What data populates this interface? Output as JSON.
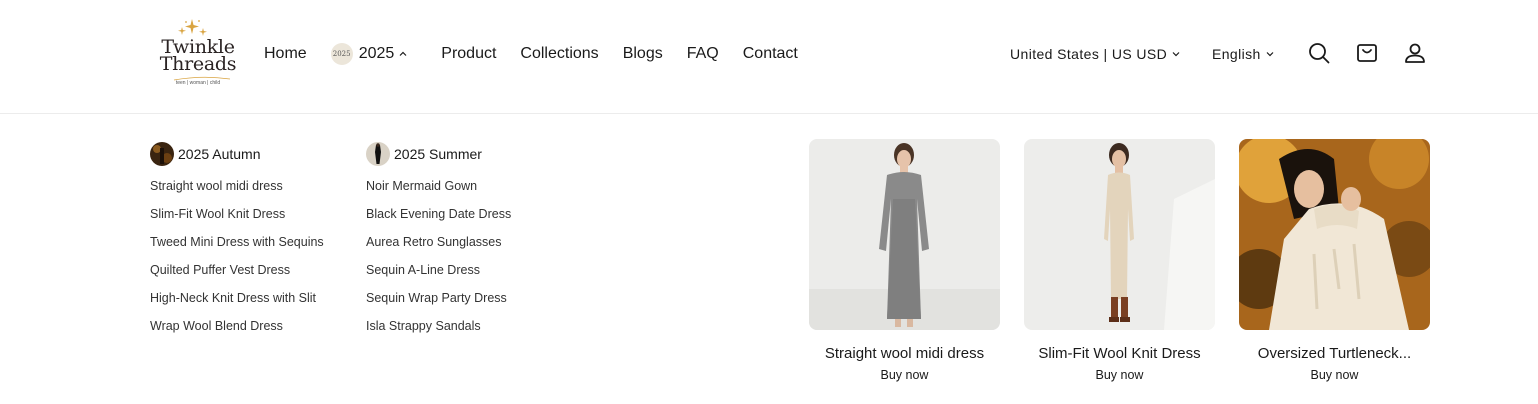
{
  "brand": {
    "name_line1": "Twinkle",
    "name_line2": "Threads",
    "tagline": "teen | woman | child"
  },
  "nav": {
    "items": [
      {
        "label": "Home"
      },
      {
        "label": "2025",
        "badge": "2025",
        "has_dropdown": true
      },
      {
        "label": "Product"
      },
      {
        "label": "Collections"
      },
      {
        "label": "Blogs"
      },
      {
        "label": "FAQ"
      },
      {
        "label": "Contact"
      }
    ]
  },
  "utility": {
    "region": "United States | US USD",
    "language": "English",
    "icons": [
      "search-icon",
      "cart-icon",
      "account-icon"
    ]
  },
  "mega_menu": {
    "columns": [
      {
        "title": "2025 Autumn",
        "links": [
          "Straight wool midi dress",
          "Slim-Fit Wool Knit Dress",
          "Tweed Mini Dress with Sequins",
          "Quilted Puffer Vest Dress",
          "High-Neck Knit Dress with Slit",
          "Wrap Wool Blend Dress"
        ]
      },
      {
        "title": "2025 Summer",
        "links": [
          "Noir Mermaid Gown",
          "Black Evening Date Dress",
          "Aurea Retro Sunglasses",
          "Sequin A-Line Dress",
          "Sequin Wrap Party Dress",
          "Isla Strappy Sandals"
        ]
      }
    ],
    "products": [
      {
        "name": "Straight wool midi dress",
        "cta": "Buy now"
      },
      {
        "name": "Slim-Fit Wool Knit Dress",
        "cta": "Buy now"
      },
      {
        "name": "Oversized Turtleneck...",
        "cta": "Buy now"
      }
    ]
  },
  "colors": {
    "text": "#1a1a1a",
    "logo_gold": "#d9a441",
    "divider": "#ececec"
  }
}
